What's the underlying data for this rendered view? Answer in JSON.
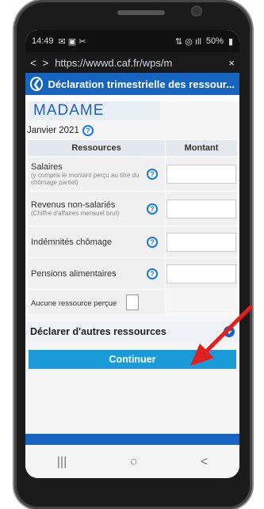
{
  "status": {
    "time": "14:49",
    "battery": "50%"
  },
  "browser": {
    "url": "https://wwwd.caf.fr/wps/m",
    "back": "<",
    "forward": ">",
    "close": "×"
  },
  "header": {
    "title": "Déclaration trimestrielle des ressour..."
  },
  "page": {
    "name": "MADAME",
    "period": "Janvier 2021",
    "table": {
      "col_resources": "Ressources",
      "col_amount": "Montant",
      "rows": [
        {
          "label": "Salaires",
          "sub": "(y compris le montant perçu au titre du chômage partiel)"
        },
        {
          "label": "Revenus non-salariés",
          "sub": "(Chiffre d'affaires mensuel brut)"
        },
        {
          "label": "Indémnités chômage",
          "sub": ""
        },
        {
          "label": "Pensions alimentaires",
          "sub": ""
        }
      ],
      "no_resource_label": "Aucune ressource perçue"
    },
    "declare_other": "Déclarer d'autres ressources",
    "continue_button": "Continuer"
  },
  "navbar": {
    "recent": "|||",
    "home": "○",
    "back": "<"
  },
  "colors": {
    "header": "#1565c0",
    "continue": "#1a9bd7",
    "arrow": "#e02020"
  }
}
